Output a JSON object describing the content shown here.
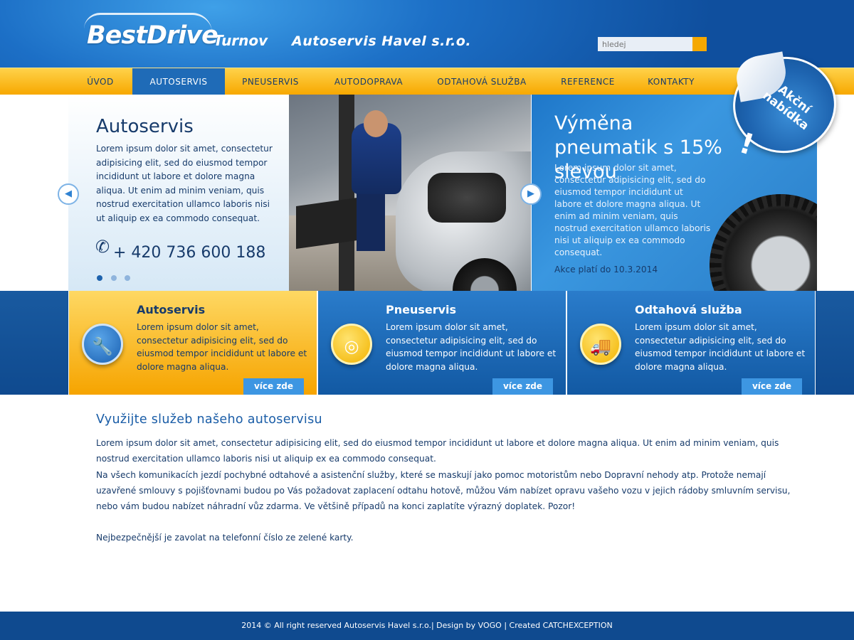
{
  "header": {
    "logo_brand": "BestDrive",
    "logo_city": "Turnov",
    "company_name": "Autoservis Havel s.r.o.",
    "search_placeholder": "hledej"
  },
  "nav": {
    "items": [
      {
        "label": "ÚVOD",
        "active": false
      },
      {
        "label": "AUTOSERVIS",
        "active": true
      },
      {
        "label": "PNEUSERVIS",
        "active": false
      },
      {
        "label": "AUTODOPRAVA",
        "active": false
      },
      {
        "label": "ODTAHOVÁ SLUŽBA",
        "active": false
      },
      {
        "label": "REFERENCE",
        "active": false
      },
      {
        "label": "KONTAKTY",
        "active": false
      }
    ]
  },
  "hero": {
    "slide_title": "Autoservis",
    "slide_text": "Lorem ipsum dolor sit amet, consectetur adipisicing elit, sed do eiusmod tempor incididunt ut labore et dolore magna aliqua. Ut enim ad minim veniam, quis nostrud exercitation ullamco laboris nisi ut aliquip ex ea commodo consequat.",
    "phone": "+ 420 736 600 188",
    "active_dot": 1,
    "dot_count": 3,
    "promo_title": "Výměna pneumatik s 15% slevou",
    "promo_text": "Lorem ipsum dolor sit amet, consectetur adipisicing elit, sed do eiusmod tempor incididunt ut labore et dolore magna aliqua. Ut enim ad minim veniam, quis nostrud exercitation ullamco laboris nisi ut aliquip ex ea commodo consequat.",
    "promo_valid": "Akce platí do 10.3.2014",
    "badge_text": "Akční nabídka",
    "badge_exclaim": "!"
  },
  "services": [
    {
      "title": "Autoservis",
      "text": "Lorem ipsum dolor sit amet, consectetur adipisicing elit, sed do eiusmod tempor incididunt ut labore et dolore magna aliqua.",
      "button": "více zde",
      "icon": "wrench-car-icon"
    },
    {
      "title": "Pneuservis",
      "text": "Lorem ipsum dolor sit amet, consectetur adipisicing elit, sed do eiusmod tempor incididunt ut labore et dolore magna aliqua.",
      "button": "více zde",
      "icon": "tire-icon"
    },
    {
      "title": "Odtahová služba",
      "text": "Lorem ipsum dolor sit amet, consectetur adipisicing elit, sed do eiusmod tempor incididunt ut labore et dolore magna aliqua.",
      "button": "více zde",
      "icon": "tow-truck-icon"
    }
  ],
  "main": {
    "title": "Využijte služeb našeho autoservisu",
    "paragraph1": "Lorem ipsum dolor sit amet, consectetur adipisicing elit, sed do eiusmod tempor incididunt ut labore et dolore magna aliqua. Ut enim ad minim veniam, quis nostrud exercitation ullamco laboris nisi ut aliquip ex ea commodo consequat.",
    "paragraph2": "Na všech komunikacích jezdí pochybné odtahové a asistenční služby, které se maskují jako pomoc motoristům nebo Dopravní nehody atp.  Protože nemají uzavřené smlouvy s pojišťovnami budou po Vás požadovat zaplacení odtahu hotově, můžou Vám nabízet opravu vašeho vozu v jejich rádoby smluvním servisu, nebo vám budou nabízet náhradní vůz zdarma. Ve většině případů na konci zaplatíte výrazný doplatek. Pozor!",
    "paragraph3": "Nejbezpečnější je zavolat na telefonní číslo ze zelené karty."
  },
  "footer": {
    "prefix": "2014 © All right reserved",
    "company": "Autoservis Havel s.r.o.",
    "design_label": "| Design by",
    "design_by": "VOGO",
    "created_label": "| Created",
    "created_by": "CATCHEXCEPTION"
  },
  "colors": {
    "brand_blue": "#1f6bb7",
    "brand_yellow": "#f7a800",
    "text_dark": "#173b6b"
  }
}
